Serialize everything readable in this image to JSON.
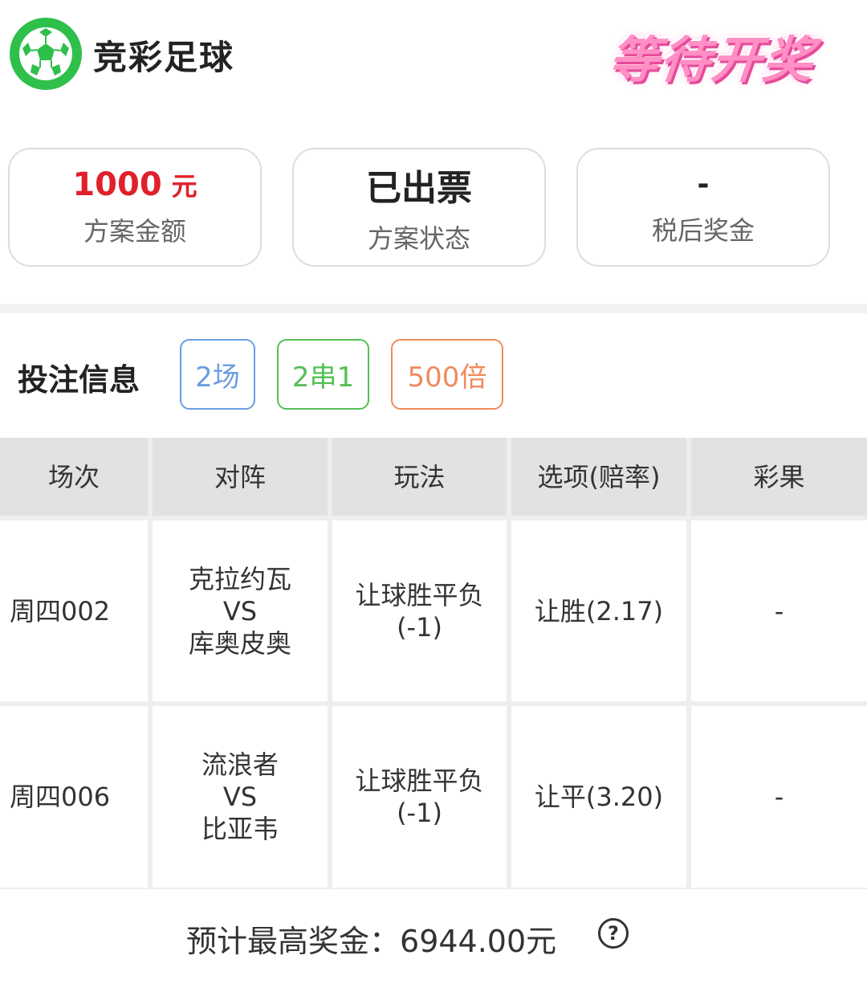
{
  "header": {
    "app_title": "竞彩足球",
    "status_stamp": "等待开奖"
  },
  "cards": {
    "amount": {
      "value": "1000",
      "unit": "元",
      "label": "方案金额"
    },
    "status": {
      "value": "已出票",
      "label": "方案状态"
    },
    "after_tax_prize": {
      "value": "-",
      "label": "税后奖金"
    }
  },
  "bet_info": {
    "title": "投注信息",
    "tags": {
      "matches": "2场",
      "combo": "2串1",
      "multiple": "500倍"
    }
  },
  "table": {
    "headers": [
      "场次",
      "对阵",
      "玩法",
      "选项(赔率)",
      "彩果"
    ],
    "rows": [
      {
        "match_no": "周四002",
        "home": "克拉约瓦",
        "vs": "VS",
        "away": "库奥皮奥",
        "play": "让球胜平负",
        "handicap": "(-1)",
        "option": "让胜(2.17)",
        "result": "-"
      },
      {
        "match_no": "周四006",
        "home": "流浪者",
        "vs": "VS",
        "away": "比亚韦",
        "play": "让球胜平负",
        "handicap": "(-1)",
        "option": "让平(3.20)",
        "result": "-"
      }
    ]
  },
  "footer": {
    "label": "预计最高奖金：",
    "amount": "6944.00元",
    "help_icon_glyph": "?"
  },
  "colors": {
    "brand_green": "#2fbf4b",
    "amount_red": "#e0202a",
    "tag_blue": "#6a9ee0",
    "tag_green": "#54c054",
    "tag_orange": "#f08a5d",
    "stamp_pink": "#ff8fc4"
  }
}
